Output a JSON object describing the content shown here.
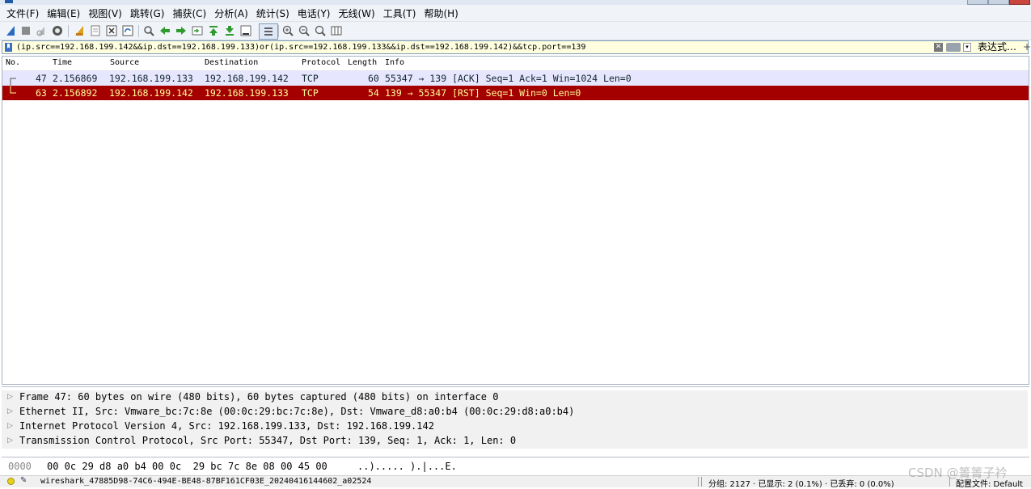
{
  "menu": [
    "文件(F)",
    "编辑(E)",
    "视图(V)",
    "跳转(G)",
    "捕获(C)",
    "分析(A)",
    "统计(S)",
    "电话(Y)",
    "无线(W)",
    "工具(T)",
    "帮助(H)"
  ],
  "filter": {
    "value": "(ip.src==192.168.199.142&&ip.dst==192.168.199.133)or(ip.src==192.168.199.133&&ip.dst==192.168.199.142)&&tcp.port==139",
    "clear_glyph": "✕",
    "expression_label": "表达式…",
    "add_label": "+"
  },
  "packet_list": {
    "headers": [
      "No.",
      "Time",
      "Source",
      "Destination",
      "Protocol",
      "Length",
      "Info"
    ],
    "rows": [
      {
        "no": "47",
        "time": "2.156869",
        "source": "192.168.199.133",
        "destination": "192.168.199.142",
        "protocol": "TCP",
        "length": "60",
        "info": "55347 → 139 [ACK] Seq=1 Ack=1 Win=1024 Len=0",
        "colors": {
          "bg": "#e7e6ff",
          "fg": "#12272e"
        }
      },
      {
        "no": "63",
        "time": "2.156892",
        "source": "192.168.199.142",
        "destination": "192.168.199.133",
        "protocol": "TCP",
        "length": "54",
        "info": "139 → 55347 [RST] Seq=1 Win=0 Len=0",
        "colors": {
          "bg": "#a40000",
          "fg": "#fffc9c"
        }
      }
    ]
  },
  "details": [
    "Frame 47: 60 bytes on wire (480 bits), 60 bytes captured (480 bits) on interface 0",
    "Ethernet II, Src: Vmware_bc:7c:8e (00:0c:29:bc:7c:8e), Dst: Vmware_d8:a0:b4 (00:0c:29:d8:a0:b4)",
    "Internet Protocol Version 4, Src: 192.168.199.133, Dst: 192.168.199.142",
    "Transmission Control Protocol, Src Port: 55347, Dst Port: 139, Seq: 1, Ack: 1, Len: 0"
  ],
  "bytes": {
    "offset": "0000",
    "hex": "00 0c 29 d8 a0 b4 00 0c  29 bc 7c 8e 08 00 45 00",
    "ascii": "..)..... ).|...E."
  },
  "status": {
    "file": "wireshark_47885D98-74C6-494E-BE48-87BF161CF03E_20240416144602_a02524",
    "counts": "分组: 2127 · 已显示: 2 (0.1%) · 已丢弃: 0 (0.0%)",
    "profile": "配置文件: Default"
  },
  "watermark": "CSDN @箐箐子衿",
  "icons": {
    "toolbar": [
      "shark-fin-start-icon",
      "stop-icon",
      "restart-icon",
      "capture-options-icon",
      "open-icon",
      "file-icon",
      "close-file-icon",
      "reload-icon",
      "find-icon",
      "back-icon",
      "forward-icon",
      "goto-packet-icon",
      "first-packet-icon",
      "last-packet-icon",
      "autoscroll-icon",
      "colorize-icon",
      "zoom-in-icon",
      "zoom-out-icon",
      "normal-size-icon",
      "resize-columns-icon"
    ]
  }
}
